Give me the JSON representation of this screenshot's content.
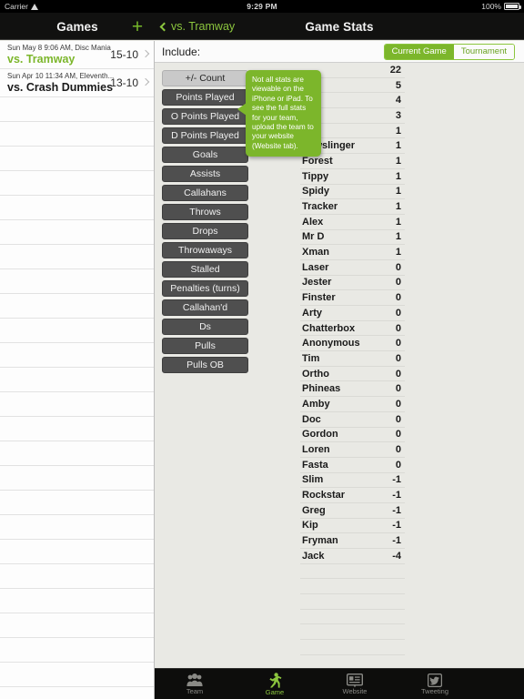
{
  "statusbar": {
    "carrier": "Carrier",
    "wifi_icon": "wifi-icon",
    "time": "9:29 PM",
    "battery_pct": "100%",
    "battery_icon": "battery-icon"
  },
  "sidebar": {
    "title": "Games",
    "add_label": "+",
    "games": [
      {
        "date": "Sun May 8 9:06 AM, Disc Mania",
        "opponent": "vs. Tramway",
        "score": "15-10",
        "selected": true
      },
      {
        "date": "Sun Apr 10 11:34 AM, Eleventh...",
        "opponent": "vs. Crash Dummies",
        "score": "13-10",
        "selected": false
      }
    ],
    "empty_row_count": 24
  },
  "detail": {
    "back_label": "vs. Tramway",
    "title": "Game Stats",
    "include_label": "Include:",
    "segmented": {
      "options": [
        "Current Game",
        "Tournament"
      ],
      "selected": "Current Game"
    },
    "stat_buttons": [
      {
        "label": "+/- Count",
        "selected": true
      },
      {
        "label": "Points Played",
        "selected": false
      },
      {
        "label": "O Points Played",
        "selected": false
      },
      {
        "label": "D Points Played",
        "selected": false
      },
      {
        "label": "Goals",
        "selected": false
      },
      {
        "label": "Assists",
        "selected": false
      },
      {
        "label": "Callahans",
        "selected": false
      },
      {
        "label": "Throws",
        "selected": false
      },
      {
        "label": "Drops",
        "selected": false
      },
      {
        "label": "Throwaways",
        "selected": false
      },
      {
        "label": "Stalled",
        "selected": false
      },
      {
        "label": "Penalties (turns)",
        "selected": false
      },
      {
        "label": "Callahan'd",
        "selected": false
      },
      {
        "label": "Ds",
        "selected": false
      },
      {
        "label": "Pulls",
        "selected": false
      },
      {
        "label": "Pulls OB",
        "selected": false
      }
    ],
    "callout_text": "Not all stats are viewable on the iPhone or iPad.  To see the full stats for your team, upload the team to your website (Website tab).",
    "players": [
      {
        "name": "",
        "value": "22",
        "obscured": true
      },
      {
        "name": "",
        "value": "5",
        "obscured": true
      },
      {
        "name": "",
        "value": "4",
        "obscured": true
      },
      {
        "name": "",
        "value": "3",
        "obscured": true
      },
      {
        "name": "",
        "value": "1",
        "obscured": true
      },
      {
        "name": "Lowslinger",
        "value": "1",
        "obscured": false
      },
      {
        "name": "Forest",
        "value": "1",
        "obscured": false
      },
      {
        "name": "Tippy",
        "value": "1",
        "obscured": false
      },
      {
        "name": "Spidy",
        "value": "1",
        "obscured": false
      },
      {
        "name": "Tracker",
        "value": "1",
        "obscured": false
      },
      {
        "name": "Alex",
        "value": "1",
        "obscured": false
      },
      {
        "name": "Mr D",
        "value": "1",
        "obscured": false
      },
      {
        "name": "Xman",
        "value": "1",
        "obscured": false
      },
      {
        "name": "Laser",
        "value": "0",
        "obscured": false
      },
      {
        "name": "Jester",
        "value": "0",
        "obscured": false
      },
      {
        "name": "Finster",
        "value": "0",
        "obscured": false
      },
      {
        "name": "Arty",
        "value": "0",
        "obscured": false
      },
      {
        "name": "Chatterbox",
        "value": "0",
        "obscured": false
      },
      {
        "name": "Anonymous",
        "value": "0",
        "obscured": false
      },
      {
        "name": "Tim",
        "value": "0",
        "obscured": false
      },
      {
        "name": "Ortho",
        "value": "0",
        "obscured": false
      },
      {
        "name": "Phineas",
        "value": "0",
        "obscured": false
      },
      {
        "name": "Amby",
        "value": "0",
        "obscured": false
      },
      {
        "name": "Doc",
        "value": "0",
        "obscured": false
      },
      {
        "name": "Gordon",
        "value": "0",
        "obscured": false
      },
      {
        "name": "Loren",
        "value": "0",
        "obscured": false
      },
      {
        "name": "Fasta",
        "value": "0",
        "obscured": false
      },
      {
        "name": "Slim",
        "value": "-1",
        "obscured": false
      },
      {
        "name": "Rockstar",
        "value": "-1",
        "obscured": false
      },
      {
        "name": "Greg",
        "value": "-1",
        "obscured": false
      },
      {
        "name": "Kip",
        "value": "-1",
        "obscured": false
      },
      {
        "name": "Fryman",
        "value": "-1",
        "obscured": false
      },
      {
        "name": "Jack",
        "value": "-4",
        "obscured": false
      }
    ],
    "empty_row_count": 7
  },
  "tabbar": {
    "tabs": [
      {
        "label": "Team",
        "icon": "team-icon",
        "active": false
      },
      {
        "label": "Game",
        "icon": "runner-icon",
        "active": true
      },
      {
        "label": "Website",
        "icon": "website-icon",
        "active": false
      },
      {
        "label": "Tweeting",
        "icon": "twitter-icon",
        "active": false
      }
    ]
  },
  "colors": {
    "accent_green": "#7cb62b",
    "nav_black": "#111110",
    "page_bg": "#e9e9e4"
  }
}
